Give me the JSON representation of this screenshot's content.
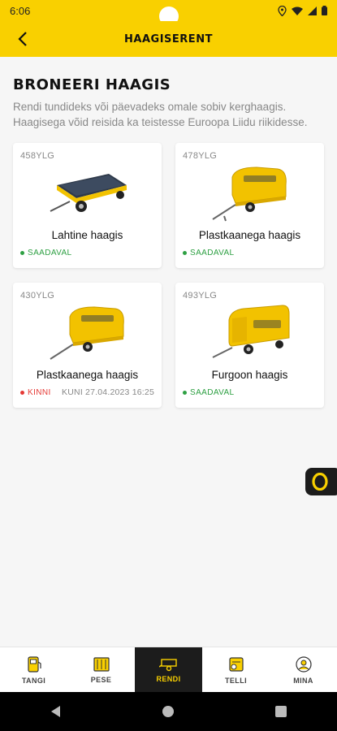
{
  "status_bar": {
    "time": "6:06"
  },
  "app_bar": {
    "title": "HAAGISERENT"
  },
  "page": {
    "heading": "BRONEERI HAAGIS",
    "description": "Rendi tundideks või päevadeks omale sobiv kerghaagis. Haagisega võid reisida ka teistesse Euroopa Liidu riikidesse."
  },
  "trailers": [
    {
      "plate": "458YLG",
      "name": "Lahtine haagis",
      "status": "SAADAVAL",
      "until": ""
    },
    {
      "plate": "478YLG",
      "name": "Plastkaanega haagis",
      "status": "SAADAVAL",
      "until": ""
    },
    {
      "plate": "430YLG",
      "name": "Plastkaanega haagis",
      "status": "KINNI",
      "until": "KUNI 27.04.2023 16:25"
    },
    {
      "plate": "493YLG",
      "name": "Furgoon haagis",
      "status": "SAADAVAL",
      "until": ""
    }
  ],
  "colors": {
    "brand_yellow": "#f9d000",
    "available": "#2ea043",
    "busy": "#e53935",
    "dark": "#1c1c1c"
  },
  "bottom_nav": [
    {
      "label": "TANGI",
      "icon": "fuel-pump-icon"
    },
    {
      "label": "PESE",
      "icon": "car-wash-icon"
    },
    {
      "label": "RENDI",
      "icon": "trailer-icon"
    },
    {
      "label": "TELLI",
      "icon": "order-icon"
    },
    {
      "label": "MINA",
      "icon": "profile-icon"
    }
  ]
}
